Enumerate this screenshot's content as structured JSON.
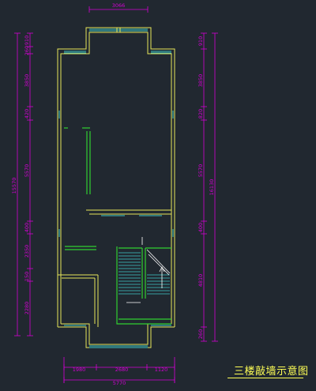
{
  "drawing": {
    "title": "三楼敲墙示意图",
    "colors": {
      "background": "#212830",
      "wall": "#e6e65a",
      "dimension": "#d400d4",
      "window": "#40c8c8",
      "stair": "#30d030",
      "annotation": "#ffffff"
    },
    "dimensions": {
      "top": "3066",
      "left": {
        "overall": "15570",
        "segments": [
          "910",
          "260",
          "3850",
          "420",
          "5570",
          "400",
          "2350",
          "150",
          "2280"
        ]
      },
      "right": {
        "overall": "16130",
        "segments": [
          "910",
          "3850",
          "820",
          "5570",
          "400",
          "4810",
          "260"
        ]
      },
      "bottom": {
        "overall": "5770",
        "segments": [
          "1980",
          "2680",
          "1120"
        ]
      }
    }
  }
}
